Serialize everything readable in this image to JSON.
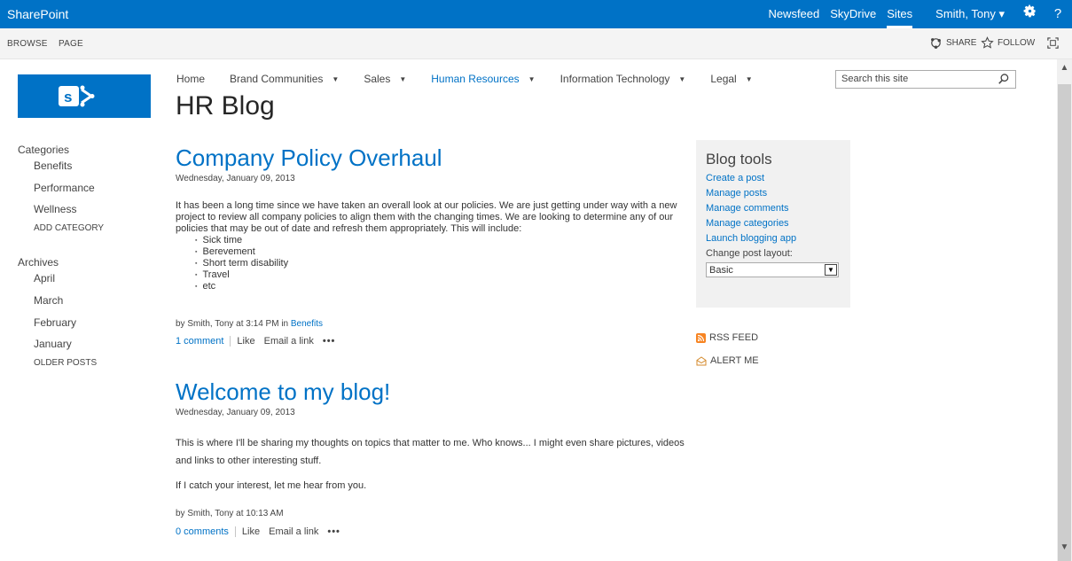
{
  "suitebar": {
    "brand": "SharePoint",
    "links": [
      "Newsfeed",
      "SkyDrive",
      "Sites"
    ],
    "user": "Smith, Tony ▾",
    "settings_icon": "gear-icon",
    "help_icon": "help-icon",
    "help_label": "?",
    "colors": {
      "bar": "#0072c6"
    }
  },
  "ribbon": {
    "tabs": [
      "BROWSE",
      "PAGE"
    ],
    "share": "SHARE",
    "follow": "FOLLOW"
  },
  "topnav": {
    "items": [
      "Home",
      "Brand Communities",
      "Sales",
      "Human Resources",
      "Information Technology",
      "Legal"
    ],
    "search_placeholder": "Search this site"
  },
  "site_title": "HR Blog",
  "leftnav": {
    "categories_heading": "Categories",
    "categories": [
      "Benefits",
      "Performance",
      "Wellness",
      "ADD CATEGORY"
    ],
    "archives_heading": "Archives",
    "archives": [
      "April",
      "March",
      "February",
      "January",
      "OLDER POSTS"
    ]
  },
  "posts": [
    {
      "title": "Company Policy Overhaul",
      "date": "Wednesday, January 09, 2013",
      "paragraph": "It has been a long time since we have taken an overall look at our policies.  We are just getting under way with a new project to review all company policies to align them with the changing times.  We are looking to determine any of our policies that may be out of date and refresh them appropriately.  This will include:",
      "bullets": [
        "Sick time",
        "Berevement",
        "Short term disability",
        "Travel",
        "etc"
      ],
      "byline": "by Smith, Tony at 3:14 PM in ",
      "category": "Benefits",
      "comments": "1 comment",
      "like": "Like",
      "email": "Email a link",
      "more": "•••"
    },
    {
      "title": "Welcome to my blog!",
      "date": "Wednesday, January 09, 2013",
      "paragraph1": "This is where I'll be sharing my thoughts on topics that matter to me. Who knows... I might even share pictures, videos and links to other interesting stuff.",
      "paragraph2": "If I catch your interest, let me hear from you.",
      "byline": "by Smith, Tony at 10:13 AM",
      "comments": "0 comments",
      "like": "Like",
      "email": "Email a link",
      "more": "•••"
    }
  ],
  "blogtools": {
    "title": "Blog tools",
    "links": [
      "Create a post",
      "Manage posts",
      "Manage comments",
      "Manage categories",
      "Launch blogging app"
    ],
    "layout_label": "Change post layout:",
    "layout_value": "Basic"
  },
  "side": {
    "rss": "RSS FEED",
    "alert": "ALERT ME"
  }
}
